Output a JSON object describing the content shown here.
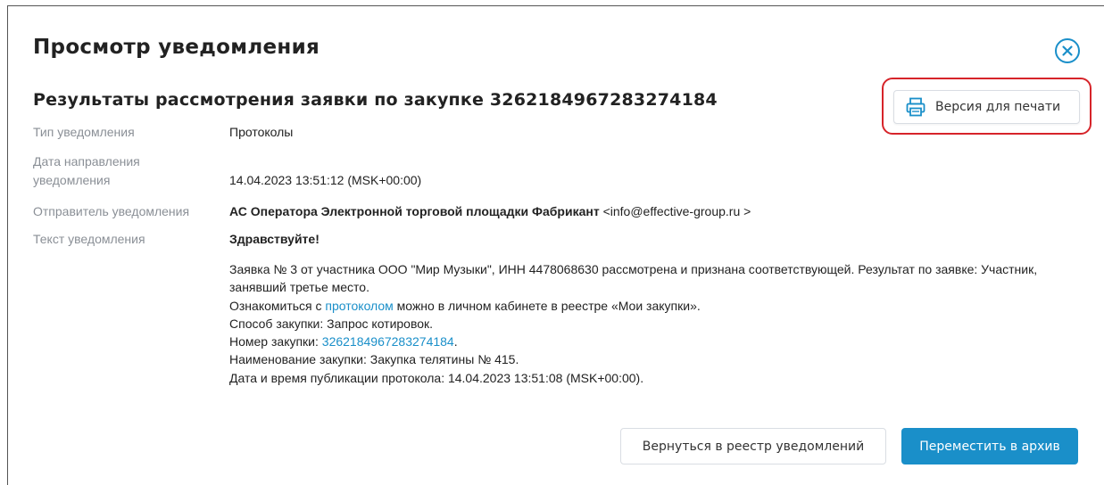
{
  "modal": {
    "title": "Просмотр уведомления",
    "close_icon": "close-circle-icon",
    "accent_color": "#1a8fc9",
    "highlight_color": "#d6242a"
  },
  "notification": {
    "subject": "Результаты рассмотрения заявки по закупке 3262184967283274184",
    "print_label": "Версия для печати",
    "print_icon": "printer-icon",
    "fields": {
      "type_label": "Тип уведомления",
      "type_value": "Протоколы",
      "date_label_1": "Дата направления",
      "date_label_2": "уведомления",
      "date_value": "14.04.2023 13:51:12 (MSK+00:00)",
      "sender_label": "Отправитель уведомления",
      "sender_name": "АС Оператора Электронной торговой площадки Фабрикант",
      "sender_email": " <info@effective-group.ru >",
      "text_label": "Текст уведомления"
    },
    "body": {
      "greeting": "Здравствуйте!",
      "line1": "Заявка № 3 от участника ООО \"Мир Музыки\", ИНН 4478068630 рассмотрена и признана соответствующей. Результат по заявке: Участник, занявший третье место.",
      "line2_prefix": "Ознакомиться с ",
      "line2_link": "протоколом",
      "line2_suffix": " можно в личном кабинете в реестре «Мои закупки».",
      "line3": "Способ закупки: Запрос котировок.",
      "line4_prefix": "Номер закупки: ",
      "line4_link": "3262184967283274184",
      "line4_suffix": ".",
      "line5": "Наименование закупки: Закупка телятины № 415.",
      "line6": "Дата и время публикации протокола: 14.04.2023 13:51:08 (MSK+00:00)."
    }
  },
  "footer": {
    "back_label": "Вернуться в реестр уведомлений",
    "archive_label": "Переместить в архив"
  }
}
